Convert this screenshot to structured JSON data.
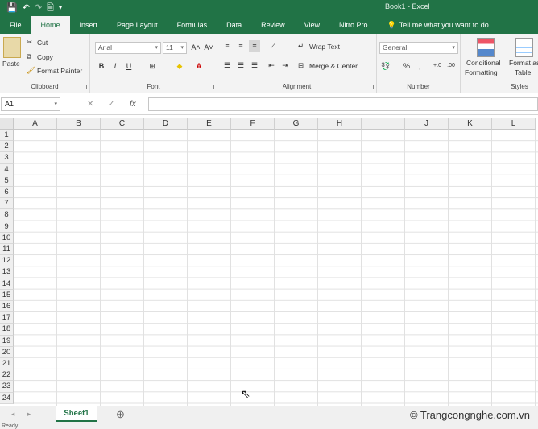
{
  "window": {
    "title": "Book1 - Excel"
  },
  "qat": {
    "save_icon": "💾",
    "undo_icon": "↶",
    "redo_icon": "↷",
    "preview_icon": "🗎",
    "customize_icon": "▾"
  },
  "tabs": [
    {
      "label": "File"
    },
    {
      "label": "Home"
    },
    {
      "label": "Insert"
    },
    {
      "label": "Page Layout"
    },
    {
      "label": "Formulas"
    },
    {
      "label": "Data"
    },
    {
      "label": "Review"
    },
    {
      "label": "View"
    },
    {
      "label": "Nitro Pro"
    }
  ],
  "tell_me": "Tell me what you want to do",
  "ribbon": {
    "clipboard": {
      "label": "Clipboard",
      "paste": "Paste",
      "cut": "Cut",
      "copy": "Copy",
      "format_painter": "Format Painter"
    },
    "font": {
      "label": "Font",
      "font_name": "Arial",
      "font_size": "11",
      "bold": "B",
      "italic": "I",
      "underline": "U"
    },
    "alignment": {
      "label": "Alignment",
      "wrap_text": "Wrap Text",
      "merge_center": "Merge & Center"
    },
    "number": {
      "label": "Number",
      "format": "General",
      "percent": "%"
    },
    "styles": {
      "label": "Styles",
      "conditional": "Conditional",
      "formatting": "Formatting",
      "format_as": "Format as",
      "table": "Table"
    }
  },
  "formula_bar": {
    "name_box": "A1",
    "fx": "fx",
    "cancel": "✕",
    "enter": "✓"
  },
  "columns": [
    "A",
    "B",
    "C",
    "D",
    "E",
    "F",
    "G",
    "H",
    "I",
    "J",
    "K",
    "L"
  ],
  "rows": [
    "1",
    "2",
    "3",
    "4",
    "5",
    "6",
    "7",
    "8",
    "9",
    "10",
    "11",
    "12",
    "13",
    "14",
    "15",
    "16",
    "17",
    "18",
    "19",
    "20",
    "21",
    "22",
    "23",
    "24"
  ],
  "sheets": [
    {
      "name": "Sheet1"
    }
  ],
  "add_sheet": "⊕",
  "watermark": "© Trangcongnghe.com.vn",
  "status": "Ready",
  "colors": {
    "accent": "#217346",
    "ribbon_bg": "#f3f3f3"
  }
}
